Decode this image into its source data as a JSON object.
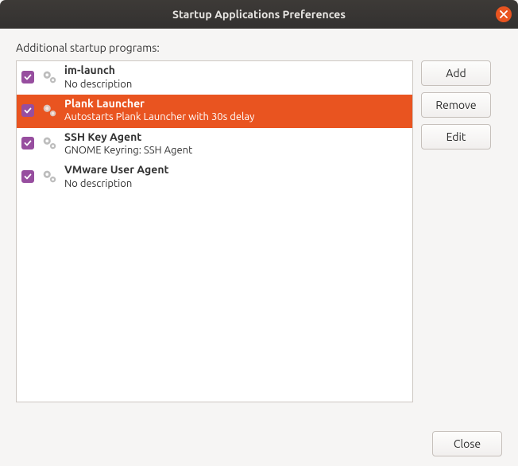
{
  "window": {
    "title": "Startup Applications Preferences"
  },
  "section_label": "Additional startup programs:",
  "items": [
    {
      "checked": true,
      "selected": false,
      "name": "im-launch",
      "desc": "No description"
    },
    {
      "checked": true,
      "selected": true,
      "name": "Plank Launcher",
      "desc": "Autostarts Plank Launcher with 30s delay"
    },
    {
      "checked": true,
      "selected": false,
      "name": "SSH Key Agent",
      "desc": "GNOME Keyring: SSH Agent"
    },
    {
      "checked": true,
      "selected": false,
      "name": "VMware User Agent",
      "desc": "No description"
    }
  ],
  "buttons": {
    "add": "Add",
    "remove": "Remove",
    "edit": "Edit",
    "close": "Close"
  },
  "colors": {
    "accent": "#e95420",
    "checkbox": "#974e9f"
  }
}
